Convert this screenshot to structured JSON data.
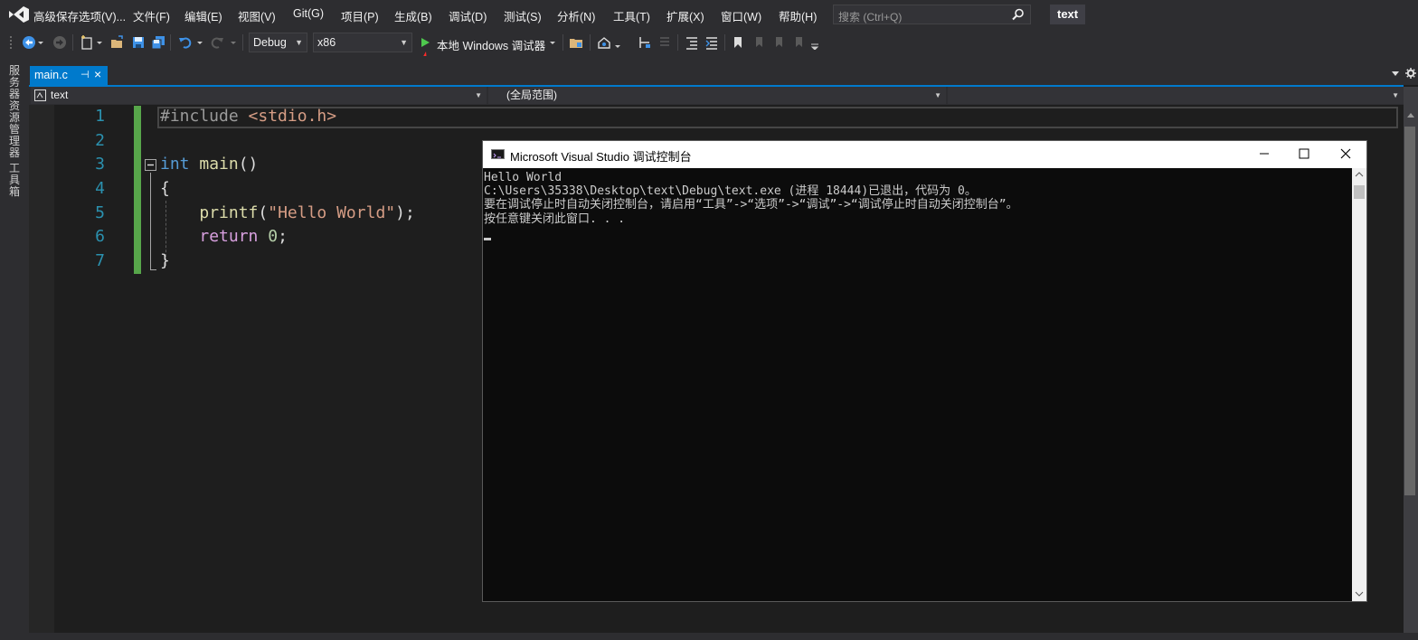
{
  "menubar": {
    "items": [
      "高级保存选项(V)...",
      "文件(F)",
      "编辑(E)",
      "视图(V)",
      "Git(G)",
      "项目(P)",
      "生成(B)",
      "调试(D)",
      "测试(S)",
      "分析(N)",
      "工具(T)",
      "扩展(X)",
      "窗口(W)",
      "帮助(H)"
    ],
    "search_placeholder": "搜索 (Ctrl+Q)",
    "project_name": "text"
  },
  "toolbar": {
    "config": "Debug",
    "platform": "x86",
    "run_label": "本地 Windows 调试器"
  },
  "side_panel": {
    "server_explorer": "服务器资源管理器",
    "toolbox": "工具箱"
  },
  "tabs": [
    {
      "label": "main.c",
      "pin": "⊣",
      "close": "×"
    }
  ],
  "navbar": {
    "project": "text",
    "scope": "(全局范围)",
    "member": ""
  },
  "editor": {
    "line_numbers": [
      "1",
      "2",
      "3",
      "4",
      "5",
      "6",
      "7"
    ]
  },
  "console": {
    "title": "Microsoft Visual Studio 调试控制台",
    "lines": [
      "Hello World",
      "C:\\Users\\35338\\Desktop\\text\\Debug\\text.exe (进程 18444)已退出，代码为 0。",
      "要在调试停止时自动关闭控制台，请启用“工具”->“选项”->“调试”->“调试停止时自动关闭控制台”。",
      "按任意键关闭此窗口. . ."
    ]
  },
  "colors": {
    "accent": "#007acc",
    "change_bar": "#57a64a",
    "run_green": "#4ec94e",
    "annotation_arrow": "#ff2a2a"
  }
}
